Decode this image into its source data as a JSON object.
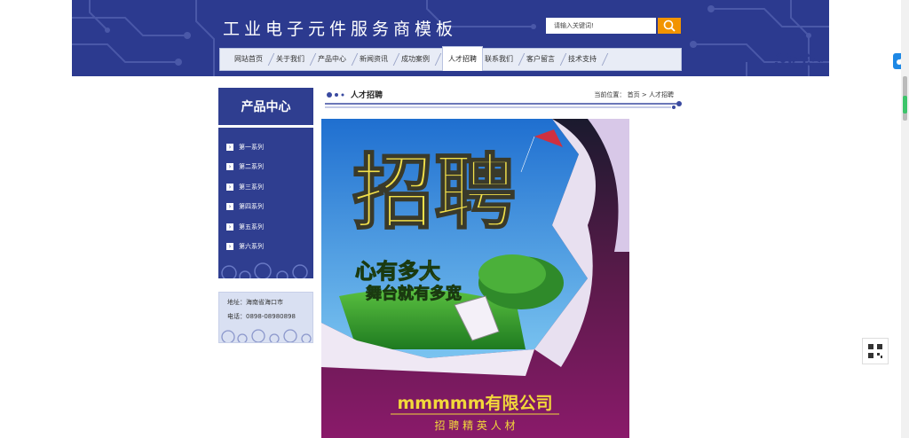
{
  "header": {
    "site_title": "工业电子元件服务商模板",
    "search_placeholder": "请输入关键词!",
    "search_value": "请输入关键词!"
  },
  "nav": {
    "items": [
      {
        "label": "网站首页"
      },
      {
        "label": "关于我们"
      },
      {
        "label": "产品中心"
      },
      {
        "label": "新闻资讯"
      },
      {
        "label": "成功案例"
      },
      {
        "label": "人才招聘"
      },
      {
        "label": "联系我们"
      },
      {
        "label": "客户留言"
      },
      {
        "label": "技术支持"
      }
    ],
    "active": "人才招聘"
  },
  "sidebar": {
    "title": "产品中心",
    "items": [
      {
        "label": "第一系列"
      },
      {
        "label": "第二系列"
      },
      {
        "label": "第三系列"
      },
      {
        "label": "第四系列"
      },
      {
        "label": "第五系列"
      },
      {
        "label": "第六系列"
      }
    ],
    "contact": {
      "address": "地址：海南省海口市",
      "phone": "电话：0898-08980898"
    }
  },
  "content": {
    "title": "人才招聘",
    "breadcrumb_prefix": "当前位置：",
    "breadcrumb_home": "首页",
    "breadcrumb_sep": ">",
    "breadcrumb_current": "人才招聘"
  },
  "poster": {
    "headline": "招聘",
    "slogan_line1": "心有多大",
    "slogan_line2": "舞台就有多宽",
    "company": "mmmmm有限公司",
    "tagline": "招 聘 精 英 人 材"
  },
  "colors": {
    "header_bg": "#2c3a8f",
    "accent": "#f29400",
    "sidebar_bg": "#2f3e90"
  }
}
